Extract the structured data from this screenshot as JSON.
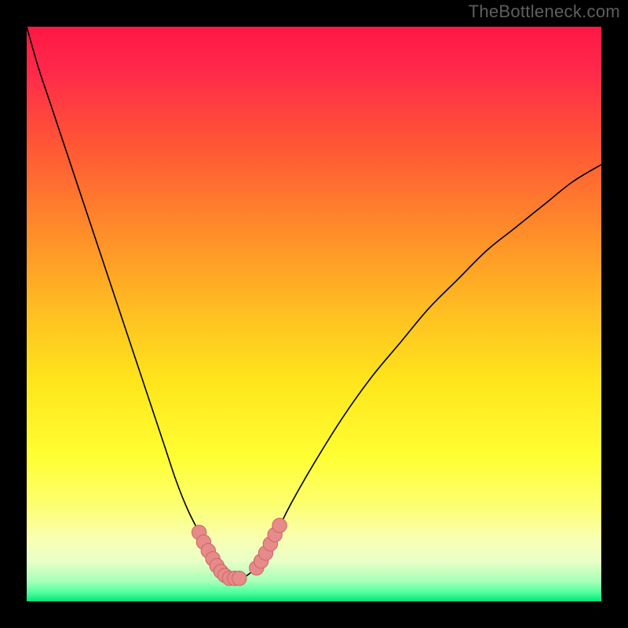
{
  "watermark": "TheBottleneck.com",
  "gradient": {
    "stops": [
      {
        "offset": 0.0,
        "color": "#ff1744"
      },
      {
        "offset": 0.08,
        "color": "#ff2a4a"
      },
      {
        "offset": 0.2,
        "color": "#ff5436"
      },
      {
        "offset": 0.35,
        "color": "#ff8a2a"
      },
      {
        "offset": 0.5,
        "color": "#ffc021"
      },
      {
        "offset": 0.62,
        "color": "#ffe61c"
      },
      {
        "offset": 0.75,
        "color": "#ffff33"
      },
      {
        "offset": 0.83,
        "color": "#fdff6e"
      },
      {
        "offset": 0.89,
        "color": "#f9ffb0"
      },
      {
        "offset": 0.93,
        "color": "#e8ffc8"
      },
      {
        "offset": 0.965,
        "color": "#a8ffb8"
      },
      {
        "offset": 0.985,
        "color": "#4dff9e"
      },
      {
        "offset": 1.0,
        "color": "#00e676"
      }
    ]
  },
  "curve_color": "#000000",
  "marker_colors": {
    "fill": "#e68a8a",
    "stroke": "#d06868"
  },
  "chart_data": {
    "type": "line",
    "title": "",
    "xlabel": "",
    "ylabel": "",
    "xlim": [
      0,
      100
    ],
    "ylim": [
      100,
      0
    ],
    "grid": false,
    "legend": false,
    "series": [
      {
        "name": "bottleneck-curve",
        "x": [
          0,
          2,
          4,
          6,
          8,
          10,
          12,
          14,
          16,
          18,
          20,
          22,
          24,
          26,
          28,
          30,
          31,
          32,
          33,
          34,
          35,
          36,
          37,
          38,
          39,
          40,
          42,
          44,
          46,
          50,
          55,
          60,
          65,
          70,
          75,
          80,
          85,
          90,
          95,
          100
        ],
        "y": [
          0,
          7,
          13,
          19,
          25,
          31,
          37,
          43,
          49,
          55,
          61,
          67,
          73,
          79,
          84,
          88,
          90,
          92,
          93.5,
          94.7,
          95.5,
          96,
          96,
          95.7,
          95,
          94,
          91,
          87,
          83,
          76,
          68,
          61,
          55,
          49,
          44,
          39,
          35,
          31,
          27,
          24
        ]
      }
    ],
    "markers": {
      "name": "highlight-dots",
      "points": [
        {
          "x": 30.0,
          "y": 88.0
        },
        {
          "x": 30.8,
          "y": 89.7
        },
        {
          "x": 31.6,
          "y": 91.2
        },
        {
          "x": 32.4,
          "y": 92.6
        },
        {
          "x": 33.1,
          "y": 93.8
        },
        {
          "x": 33.8,
          "y": 94.8
        },
        {
          "x": 34.5,
          "y": 95.5
        },
        {
          "x": 35.3,
          "y": 96.0
        },
        {
          "x": 36.2,
          "y": 96.0
        },
        {
          "x": 37.0,
          "y": 96.0
        },
        {
          "x": 40.0,
          "y": 94.2
        },
        {
          "x": 40.8,
          "y": 93.0
        },
        {
          "x": 41.6,
          "y": 91.6
        },
        {
          "x": 42.4,
          "y": 90.0
        },
        {
          "x": 43.2,
          "y": 88.4
        },
        {
          "x": 44.0,
          "y": 86.8
        }
      ]
    }
  }
}
